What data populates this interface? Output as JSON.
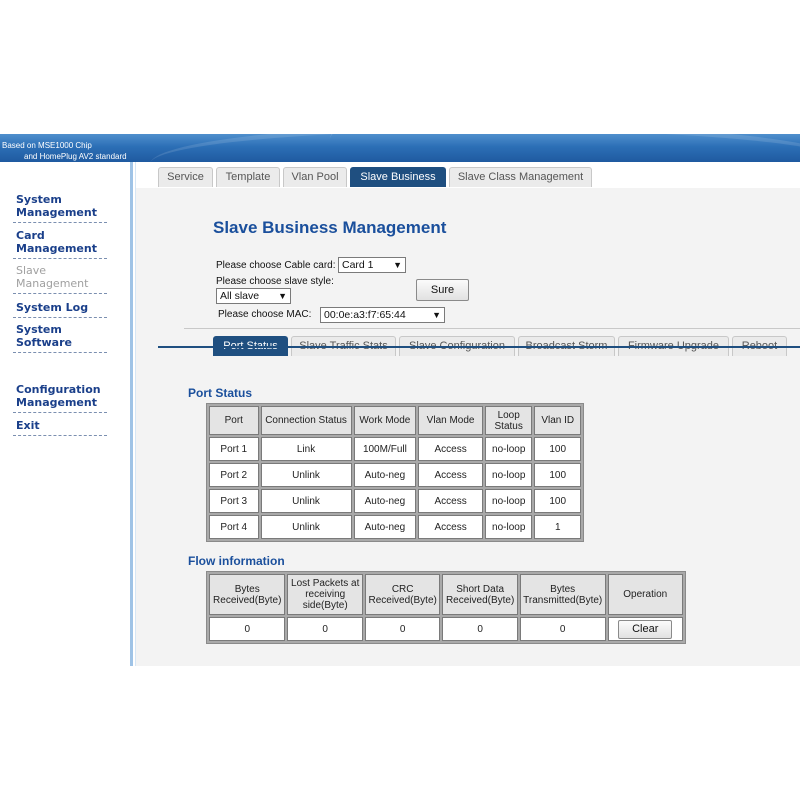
{
  "banner": {
    "line1": "Based on MSE1000 Chip",
    "line2": "and HomePlug AV2 standard"
  },
  "sidebar": {
    "items": [
      {
        "label_l1": "System",
        "label_l2": "Management",
        "active": true
      },
      {
        "label_l1": "Card",
        "label_l2": "Management",
        "active": true
      },
      {
        "label_l1": "Slave",
        "label_l2": "Management",
        "active": false
      },
      {
        "label_l1": "System Log",
        "label_l2": "",
        "active": true
      },
      {
        "label_l1": "System",
        "label_l2": "Software",
        "active": true
      },
      {
        "label_l1": "Configuration",
        "label_l2": "Management",
        "active": true
      },
      {
        "label_l1": "Exit",
        "label_l2": "",
        "active": true
      }
    ]
  },
  "top_tabs": [
    "Service",
    "Template",
    "Vlan Pool",
    "Slave Business",
    "Slave Class Management"
  ],
  "top_tab_active": "Slave Business",
  "page_title": "Slave Business Management",
  "form": {
    "cable_card_label": "Please choose Cable card:",
    "cable_card_value": "Card 1",
    "slave_style_label": "Please choose slave style:",
    "slave_style_value": "All slave",
    "sure_label": "Sure",
    "mac_label": "Please choose MAC:",
    "mac_value": "00:0e:a3:f7:65:44"
  },
  "sub_tabs": [
    "Port Status",
    "Slave Traffic Stats",
    "Slave Configuration",
    "Broadcast Storm",
    "Firmware Upgrade",
    "Reboot"
  ],
  "sub_tab_active": "Port Status",
  "port_status": {
    "title": "Port Status",
    "headers": [
      "Port",
      "Connection Status",
      "Work Mode",
      "Vlan Mode",
      "Loop Status",
      "Vlan ID"
    ],
    "rows": [
      [
        "Port 1",
        "Link",
        "100M/Full",
        "Access",
        "no-loop",
        "100"
      ],
      [
        "Port 2",
        "Unlink",
        "Auto-neg",
        "Access",
        "no-loop",
        "100"
      ],
      [
        "Port 3",
        "Unlink",
        "Auto-neg",
        "Access",
        "no-loop",
        "100"
      ],
      [
        "Port 4",
        "Unlink",
        "Auto-neg",
        "Access",
        "no-loop",
        "1"
      ]
    ]
  },
  "flow": {
    "title": "Flow information",
    "headers": [
      "Bytes Received(Byte)",
      "Lost Packets at receiving side(Byte)",
      "CRC Received(Byte)",
      "Short Data Received(Byte)",
      "Bytes Transmitted(Byte)",
      "Operation"
    ],
    "values": [
      "0",
      "0",
      "0",
      "0",
      "0"
    ],
    "clear_label": "Clear"
  }
}
